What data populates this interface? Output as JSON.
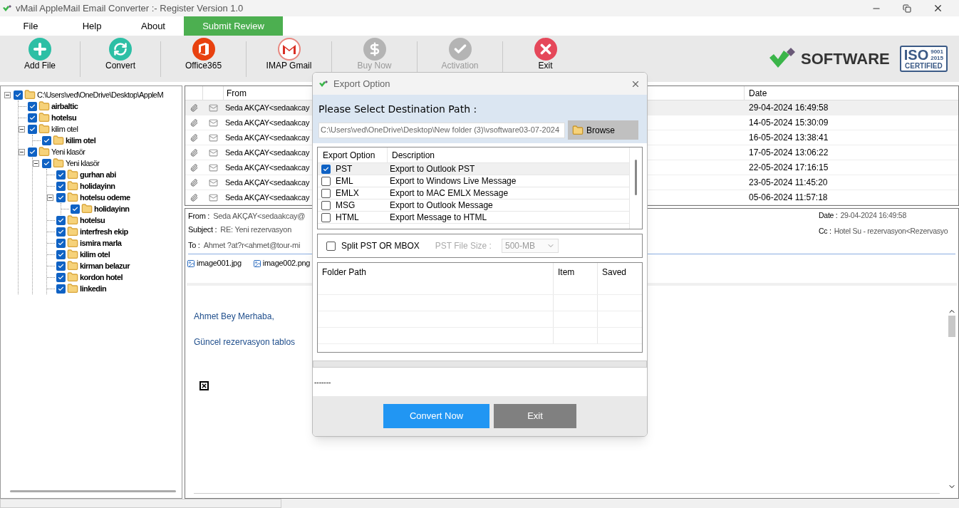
{
  "window": {
    "title": "vMail AppleMail Email Converter :- Register Version 1.0"
  },
  "menu": [
    {
      "label": "File",
      "kind": "plain"
    },
    {
      "label": "Help",
      "kind": "plain"
    },
    {
      "label": "About",
      "kind": "plain"
    },
    {
      "label": "Submit Review",
      "kind": "highlight"
    }
  ],
  "toolbar": [
    {
      "label": "Add File",
      "disabled": false
    },
    {
      "label": "Convert",
      "disabled": false
    },
    {
      "label": "Office365",
      "disabled": false
    },
    {
      "label": "IMAP Gmail",
      "disabled": false
    },
    {
      "label": "Buy Now",
      "disabled": true
    },
    {
      "label": "Activation",
      "disabled": true
    },
    {
      "label": "Exit",
      "disabled": false
    }
  ],
  "logo": {
    "brand": "SOFTWARE",
    "iso": "ISO",
    "iso_years": [
      "9001",
      "2015"
    ],
    "iso_certified": "CERTIFIED"
  },
  "tree": [
    {
      "label": "C:\\Users\\ved\\OneDrive\\Desktop\\AppleM",
      "checked": true,
      "expanded": true,
      "bold": false,
      "children": [
        {
          "label": "airbaltic",
          "checked": true,
          "bold": true
        },
        {
          "label": "hotelsu",
          "checked": true,
          "bold": true
        },
        {
          "label": "kilim otel",
          "checked": true,
          "expanded": true,
          "bold": false,
          "children": [
            {
              "label": "kilim otel",
              "checked": true,
              "bold": true
            }
          ]
        },
        {
          "label": "Yeni klasör",
          "checked": true,
          "expanded": true,
          "bold": false,
          "children": [
            {
              "label": "Yeni klasör",
              "checked": true,
              "expanded": true,
              "bold": false,
              "children": [
                {
                  "label": "gurhan abi",
                  "checked": true,
                  "bold": true
                },
                {
                  "label": "holidayinn",
                  "checked": true,
                  "bold": true
                },
                {
                  "label": "hotelsu odeme",
                  "checked": true,
                  "expanded": true,
                  "bold": true,
                  "children": [
                    {
                      "label": "holidayinn",
                      "checked": true,
                      "bold": true
                    }
                  ]
                },
                {
                  "label": "hotelsu",
                  "checked": true,
                  "bold": true
                },
                {
                  "label": "interfresh ekip",
                  "checked": true,
                  "bold": true
                },
                {
                  "label": "ismira marla",
                  "checked": true,
                  "bold": true
                },
                {
                  "label": "kilim otel",
                  "checked": true,
                  "bold": true
                },
                {
                  "label": "kirman belazur",
                  "checked": true,
                  "bold": true
                },
                {
                  "label": "kordon hotel",
                  "checked": true,
                  "bold": true
                },
                {
                  "label": "linkedin",
                  "checked": true,
                  "bold": true
                }
              ]
            }
          ]
        }
      ]
    }
  ],
  "mail_list": {
    "columns": [
      "From",
      "Date"
    ],
    "rows": [
      {
        "from": "Seda AKÇAY<sedaakcay",
        "date": "29-04-2024 16:49:58",
        "selected": true
      },
      {
        "from": "Seda AKÇAY<sedaakcay",
        "date": "14-05-2024 15:30:09",
        "selected": false
      },
      {
        "from": "Seda AKÇAY<sedaakcay",
        "date": "16-05-2024 13:38:41",
        "selected": false
      },
      {
        "from": "Seda AKÇAY<sedaakcay",
        "date": "17-05-2024 13:06:22",
        "selected": false
      },
      {
        "from": "Seda AKÇAY<sedaakcay",
        "date": "22-05-2024 17:16:15",
        "selected": false
      },
      {
        "from": "Seda AKÇAY<sedaakcay",
        "date": "23-05-2024 11:45:20",
        "selected": false
      },
      {
        "from": "Seda AKÇAY<sedaakcay",
        "date": "05-06-2024 11:57:18",
        "selected": false
      }
    ]
  },
  "preview": {
    "fields": [
      {
        "label": "From :",
        "value": "Seda AKÇAY<sedaakcay@"
      },
      {
        "label": "Subject :",
        "value": "RE: Yeni rezervasyon"
      },
      {
        "label": "To :",
        "value": "Ahmet ?at?r<ahmet@tour-mi"
      }
    ],
    "side_fields": [
      {
        "label": "Date :",
        "value": "29-04-2024 16:49:58"
      },
      {
        "label": "Cc :",
        "value": "Hotel Su - rezervasyon<Rezervasyo"
      }
    ],
    "attachments": [
      "image001.jpg",
      "image002.png"
    ],
    "body": [
      "Ahmet Bey Merhaba,",
      "Güncel rezervasyon  tablos"
    ]
  },
  "dialog": {
    "title": "Export Option",
    "path_label": "Please Select Destination Path :",
    "path": "C:\\Users\\ved\\OneDrive\\Desktop\\New folder (3)\\vsoftware03-07-2024",
    "browse": "Browse",
    "options_columns": [
      "Export Option",
      "Description"
    ],
    "options": [
      {
        "name": "PST",
        "description": "Export to Outlook PST",
        "checked": true,
        "selected": true
      },
      {
        "name": "EML",
        "description": "Export to Windows Live Message",
        "checked": false,
        "selected": false
      },
      {
        "name": "EMLX",
        "description": "Export to MAC EMLX Message",
        "checked": false,
        "selected": false
      },
      {
        "name": "MSG",
        "description": "Export to Outlook Message",
        "checked": false,
        "selected": false
      },
      {
        "name": "HTML",
        "description": "Export Message to HTML",
        "checked": false,
        "selected": false
      }
    ],
    "split": {
      "label": "Split PST OR MBOX",
      "checked": false,
      "size_label": "PST File Size :",
      "size": "500-MB",
      "disabled": true
    },
    "folder_columns": [
      "Folder Path",
      "Item",
      "Saved"
    ],
    "progress": {
      "level": 0
    },
    "status": "-------",
    "buttons": [
      {
        "label": "Convert Now",
        "kind": "primary"
      },
      {
        "label": "Exit",
        "kind": "secondary"
      }
    ]
  }
}
